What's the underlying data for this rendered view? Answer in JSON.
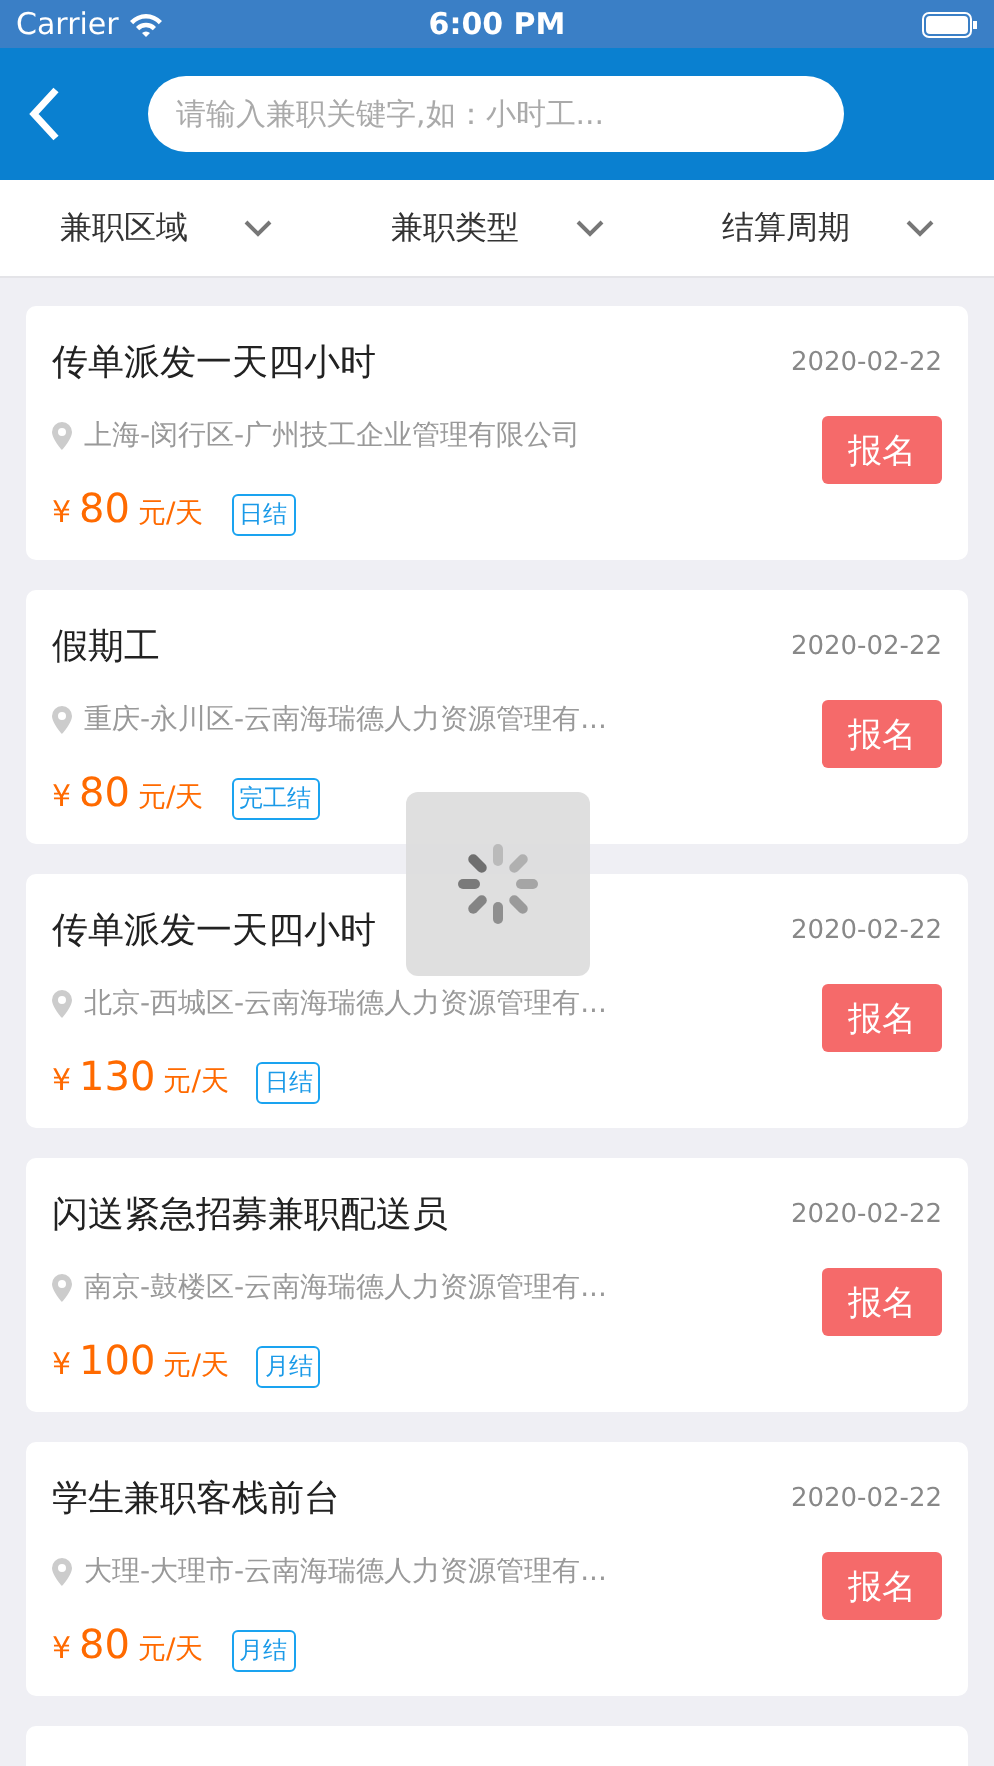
{
  "status_bar": {
    "carrier": "Carrier",
    "time": "6:00 PM"
  },
  "search": {
    "placeholder": "请输入兼职关键字,如：小时工..."
  },
  "filters": [
    {
      "label": "兼职区域"
    },
    {
      "label": "兼职类型"
    },
    {
      "label": "结算周期"
    }
  ],
  "jobs": [
    {
      "title": "传单派发一天四小时",
      "date": "2020-02-22",
      "location": "上海-闵行区-广州技工企业管理有限公司",
      "currency": "¥",
      "amount": "80",
      "unit": "元/天",
      "settlement": "日结",
      "button": "报名"
    },
    {
      "title": "假期工",
      "date": "2020-02-22",
      "location": "重庆-永川区-云南海瑞德人力资源管理有...",
      "currency": "¥",
      "amount": "80",
      "unit": "元/天",
      "settlement": "完工结",
      "button": "报名"
    },
    {
      "title": "传单派发一天四小时",
      "date": "2020-02-22",
      "location": "北京-西城区-云南海瑞德人力资源管理有...",
      "currency": "¥",
      "amount": "130",
      "unit": "元/天",
      "settlement": "日结",
      "button": "报名"
    },
    {
      "title": "闪送紧急招募兼职配送员",
      "date": "2020-02-22",
      "location": "南京-鼓楼区-云南海瑞德人力资源管理有...",
      "currency": "¥",
      "amount": "100",
      "unit": "元/天",
      "settlement": "月结",
      "button": "报名"
    },
    {
      "title": "学生兼职客栈前台",
      "date": "2020-02-22",
      "location": "大理-大理市-云南海瑞德人力资源管理有...",
      "currency": "¥",
      "amount": "80",
      "unit": "元/天",
      "settlement": "月结",
      "button": "报名"
    }
  ],
  "loading": true
}
